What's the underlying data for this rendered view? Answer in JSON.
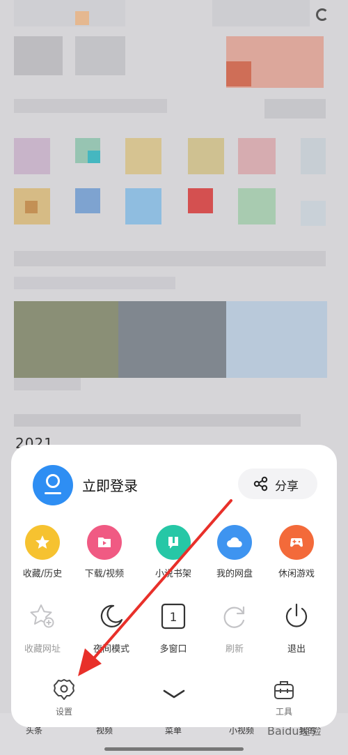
{
  "background": {
    "year_text": "2021",
    "bottom_tabs": [
      "头条",
      "视频",
      "菜单",
      "小视频",
      "我的"
    ],
    "watermark": "Baidu经验"
  },
  "menu": {
    "login_label": "立即登录",
    "share_label": "分享",
    "row1": [
      {
        "label": "收藏/历史",
        "icon": "star-icon",
        "color": "#f6c230"
      },
      {
        "label": "下载/视频",
        "icon": "folder-play-icon",
        "color": "#f05a83"
      },
      {
        "label": "小说书架",
        "icon": "book-icon",
        "color": "#26c7a6"
      },
      {
        "label": "我的网盘",
        "icon": "cloud-icon",
        "color": "#3e94f0"
      },
      {
        "label": "休闲游戏",
        "icon": "gamepad-icon",
        "color": "#f36a3a"
      }
    ],
    "row2": [
      {
        "label": "收藏网址",
        "icon": "star-add-icon",
        "disabled": true
      },
      {
        "label": "夜间模式",
        "icon": "moon-icon",
        "disabled": false
      },
      {
        "label": "多窗口",
        "icon": "window-count-icon",
        "disabled": false,
        "count": "1"
      },
      {
        "label": "刷新",
        "icon": "refresh-icon",
        "disabled": true
      },
      {
        "label": "退出",
        "icon": "power-icon",
        "disabled": false
      }
    ],
    "footer": {
      "settings_label": "设置",
      "tools_label": "工具"
    }
  },
  "annotation": {
    "arrow_color": "#e8302a"
  }
}
